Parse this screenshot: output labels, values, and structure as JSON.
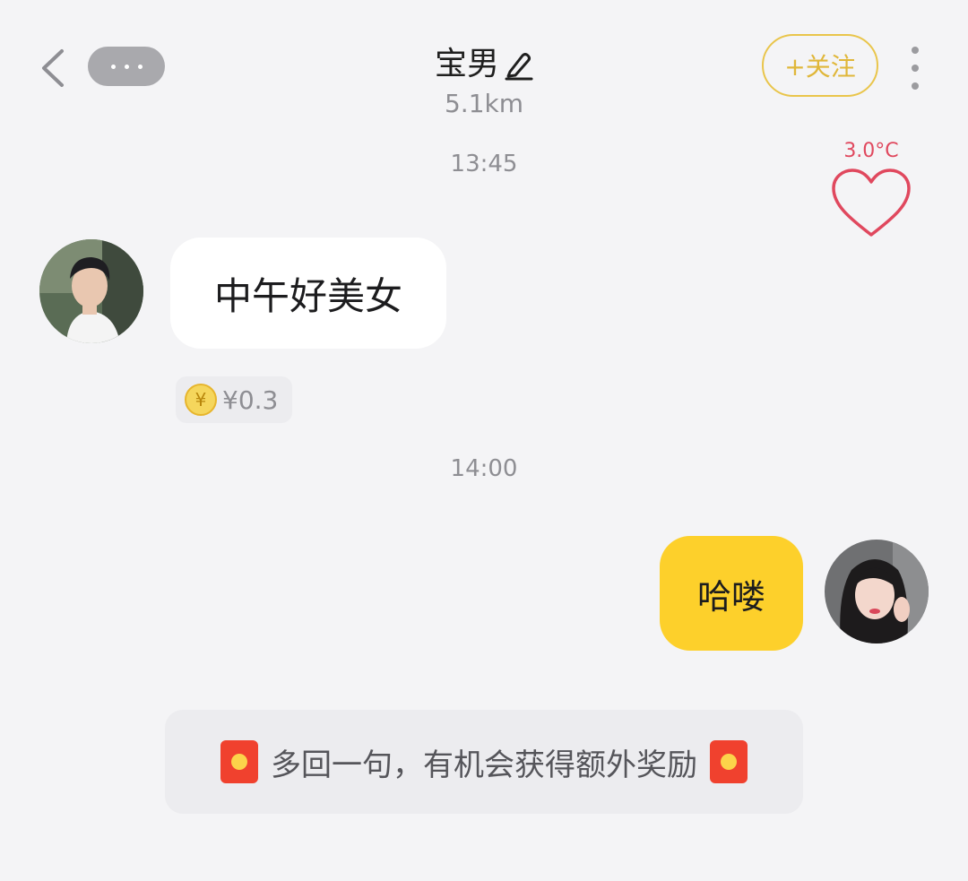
{
  "header": {
    "title": "宝男",
    "distance": "5.1km",
    "follow_label": "+关注"
  },
  "intimacy": {
    "temperature": "3.0°C",
    "accent_color": "#e0485e"
  },
  "messages": [
    {
      "timestamp": "13:45",
      "sender": "other",
      "text": "中午好美女",
      "reward": "¥0.3"
    },
    {
      "timestamp": "14:00",
      "sender": "self",
      "text": "哈喽"
    }
  ],
  "tip": {
    "text": "多回一句，有机会获得额外奖励"
  },
  "colors": {
    "self_bubble": "#fdd02b",
    "other_bubble": "#ffffff",
    "follow": "#e0b73a",
    "background": "#f4f4f6"
  },
  "icons": [
    "back-arrow-icon",
    "more-icon",
    "edit-pencil-icon",
    "kebab-menu-icon",
    "heart-icon",
    "coin-icon",
    "red-packet-icon"
  ]
}
